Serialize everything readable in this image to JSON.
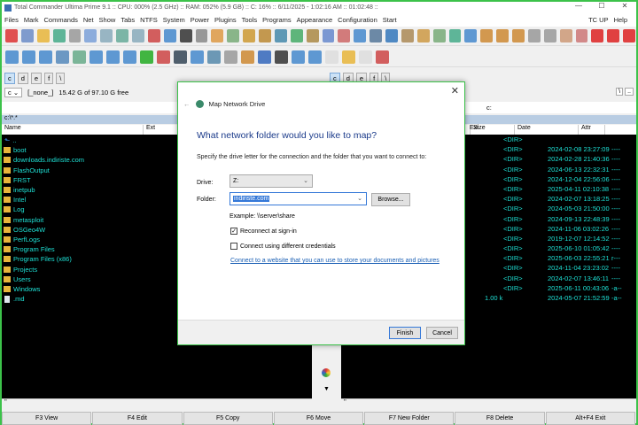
{
  "window": {
    "title": "Total Commander Ultima Prime 9.1 :: CPU: 000% (2.5 GHz) :: RAM: 052% (5.9 GB) :: C: 16% :: 6/11/2025 - 1:02:16 AM :: 01:02:48 ::",
    "minimize": "—",
    "maximize": "☐",
    "close": "✕"
  },
  "menu": {
    "items": [
      "Files",
      "Mark",
      "Commands",
      "Net",
      "Show",
      "Tabs",
      "NTFS",
      "System",
      "Power",
      "Plugins",
      "Tools",
      "Programs",
      "Appearance",
      "Configuration",
      "Start"
    ],
    "right": [
      "TC UP",
      "Help"
    ]
  },
  "toolbar1": [
    [
      "power-off-icon",
      "#d33"
    ],
    [
      "copy-icon",
      "#6b8cc7"
    ],
    [
      "folder-icon",
      "#e8b53a"
    ],
    [
      "refresh-icon",
      "#4a8"
    ],
    [
      "list-icon",
      "#999"
    ],
    [
      "details-icon",
      "#7aa0d8"
    ],
    [
      "thumbnails-icon",
      "#8ab"
    ],
    [
      "tree-icon",
      "#6a9"
    ],
    [
      "split-icon",
      "#8ab"
    ],
    [
      "toolbox-icon",
      "#c44"
    ],
    [
      "network-icon",
      "#48c"
    ],
    [
      "terminal-icon",
      "#333"
    ],
    [
      "settings-icon",
      "#888"
    ],
    [
      "mail-icon",
      "#d94"
    ],
    [
      "calc-icon",
      "#7a7"
    ],
    [
      "pack-icon",
      "#c93"
    ],
    [
      "unpack-icon",
      "#b83"
    ],
    [
      "search-icon",
      "#48a"
    ],
    [
      "sync-icon",
      "#4a6"
    ],
    [
      "compare-icon",
      "#a84"
    ],
    [
      "rename-icon",
      "#68c"
    ],
    [
      "pin-icon",
      "#c66"
    ],
    [
      "download-icon",
      "#48c"
    ],
    [
      "zoom-icon",
      "#579"
    ],
    [
      "add-icon",
      "#37b"
    ],
    [
      "clipboard-icon",
      "#a85"
    ],
    [
      "paste-icon",
      "#c94"
    ],
    [
      "checklist-icon",
      "#7a7"
    ],
    [
      "net-connect-icon",
      "#4a8"
    ],
    [
      "net-disconnect-icon",
      "#48c"
    ],
    [
      "archive-icon",
      "#c83"
    ],
    [
      "archive2-icon",
      "#c83"
    ],
    [
      "archive3-icon",
      "#c83"
    ],
    [
      "link-icon",
      "#999"
    ],
    [
      "chain-icon",
      "#999"
    ],
    [
      "jar-icon",
      "#c97"
    ],
    [
      "stamp-icon",
      "#c77"
    ],
    [
      "shutdown-icon",
      "#d22"
    ],
    [
      "restart-icon",
      "#d22"
    ],
    [
      "logoff-icon",
      "#d22"
    ]
  ],
  "toolbar2": [
    [
      "up-icon",
      "#48c"
    ],
    [
      "back-icon",
      "#48c"
    ],
    [
      "forward-icon",
      "#48c"
    ],
    [
      "view-icon",
      "#58b"
    ],
    [
      "sort-icon",
      "#6a8"
    ],
    [
      "filter-icon",
      "#48c"
    ],
    [
      "down-icon",
      "#48c"
    ],
    [
      "sync2-icon",
      "#48c"
    ],
    [
      "check-icon",
      "#2a2"
    ],
    [
      "stack-icon",
      "#c44"
    ],
    [
      "film-icon",
      "#345"
    ],
    [
      "music-icon",
      "#48c"
    ],
    [
      "image-icon",
      "#58a"
    ],
    [
      "clock-icon",
      "#999"
    ],
    [
      "crop-icon",
      "#c83"
    ],
    [
      "info-icon",
      "#36b"
    ],
    [
      "grid-icon",
      "#333"
    ],
    [
      "left-arrow-icon",
      "#48c"
    ],
    [
      "right-arrow-icon",
      "#48c"
    ],
    [
      "doc-icon",
      "#ddd"
    ],
    [
      "folder2-icon",
      "#e8b53a"
    ],
    [
      "file-icon",
      "#ddd"
    ],
    [
      "calendar-icon",
      "#c44"
    ]
  ],
  "drives": [
    "c",
    "d",
    "e",
    "f",
    "\\"
  ],
  "left": {
    "drive": "c",
    "label": "[_none_]",
    "free": "15.42 G of 97.10 G free",
    "drive_path": "c:",
    "path": "c:\\*.*",
    "cols": [
      "Name",
      "Ext"
    ],
    "status": "''"
  },
  "right": {
    "drive_path": "c:",
    "cols": [
      "Ext",
      "Size",
      "Date",
      "Attr"
    ],
    "btn_root": "\\",
    "btn_up": "..",
    "status": "''"
  },
  "files": [
    {
      "name": "..",
      "size": "<DIR>",
      "date": "",
      "attr": ""
    },
    {
      "name": "boot",
      "size": "<DIR>",
      "date": "2024-02-08 23:27:09",
      "attr": "----"
    },
    {
      "name": "downloads.indiriste.com",
      "size": "<DIR>",
      "date": "2024-02-28 21:40:36",
      "attr": "----"
    },
    {
      "name": "FlashOutput",
      "size": "<DIR>",
      "date": "2024-06-13 22:32:31",
      "attr": "----"
    },
    {
      "name": "FRST",
      "size": "<DIR>",
      "date": "2024-12-04 22:56:06",
      "attr": "----"
    },
    {
      "name": "inetpub",
      "size": "<DIR>",
      "date": "2025-04-11 02:10:38",
      "attr": "----"
    },
    {
      "name": "Intel",
      "size": "<DIR>",
      "date": "2024-02-07 13:18:25",
      "attr": "----"
    },
    {
      "name": "Log",
      "size": "<DIR>",
      "date": "2024-05-03 21:50:00",
      "attr": "----"
    },
    {
      "name": "metasploit",
      "size": "<DIR>",
      "date": "2024-09-13 22:48:39",
      "attr": "----"
    },
    {
      "name": "OSGeo4W",
      "size": "<DIR>",
      "date": "2024-11-06 03:02:26",
      "attr": "----"
    },
    {
      "name": "PerfLogs",
      "size": "<DIR>",
      "date": "2019-12-07 12:14:52",
      "attr": "----"
    },
    {
      "name": "Program Files",
      "size": "<DIR>",
      "date": "2025-06-10 01:05:42",
      "attr": "----"
    },
    {
      "name": "Program Files (x86)",
      "size": "<DIR>",
      "date": "2025-06-03 22:55:21",
      "attr": "r---"
    },
    {
      "name": "Projects",
      "size": "<DIR>",
      "date": "2024-11-04 23:23:02",
      "attr": "----"
    },
    {
      "name": "Users",
      "size": "<DIR>",
      "date": "2024-02-07 13:46:11",
      "attr": "----"
    },
    {
      "name": "Windows",
      "size": "<DIR>",
      "date": "2025-06-11 00:43:06",
      "attr": "-a--"
    },
    {
      "name": ".md",
      "size": "1.00 k",
      "date": "2024-05-07 21:52:59",
      "attr": "-a--",
      "file": true
    }
  ],
  "fkeys": [
    "F3 View",
    "F4 Edit",
    "F5 Copy",
    "F6 Move",
    "F7 New Folder",
    "F8 Delete",
    "Alt+F4 Exit"
  ],
  "dialog": {
    "title": "Map Network Drive",
    "heading": "What network folder would you like to map?",
    "description": "Specify the drive letter for the connection and the folder that you want to connect to:",
    "drive_label": "Drive:",
    "drive_value": "Z:",
    "folder_label": "Folder:",
    "folder_value": "indiriste.com",
    "browse": "Browse...",
    "example": "Example: \\\\server\\share",
    "reconnect": "Reconnect at sign-in",
    "reconnect_checked": true,
    "credentials": "Connect using different credentials",
    "credentials_checked": false,
    "link": "Connect to a website that you can use to store your documents and pictures",
    "finish": "Finish",
    "cancel": "Cancel",
    "close": "✕",
    "back": "←"
  }
}
